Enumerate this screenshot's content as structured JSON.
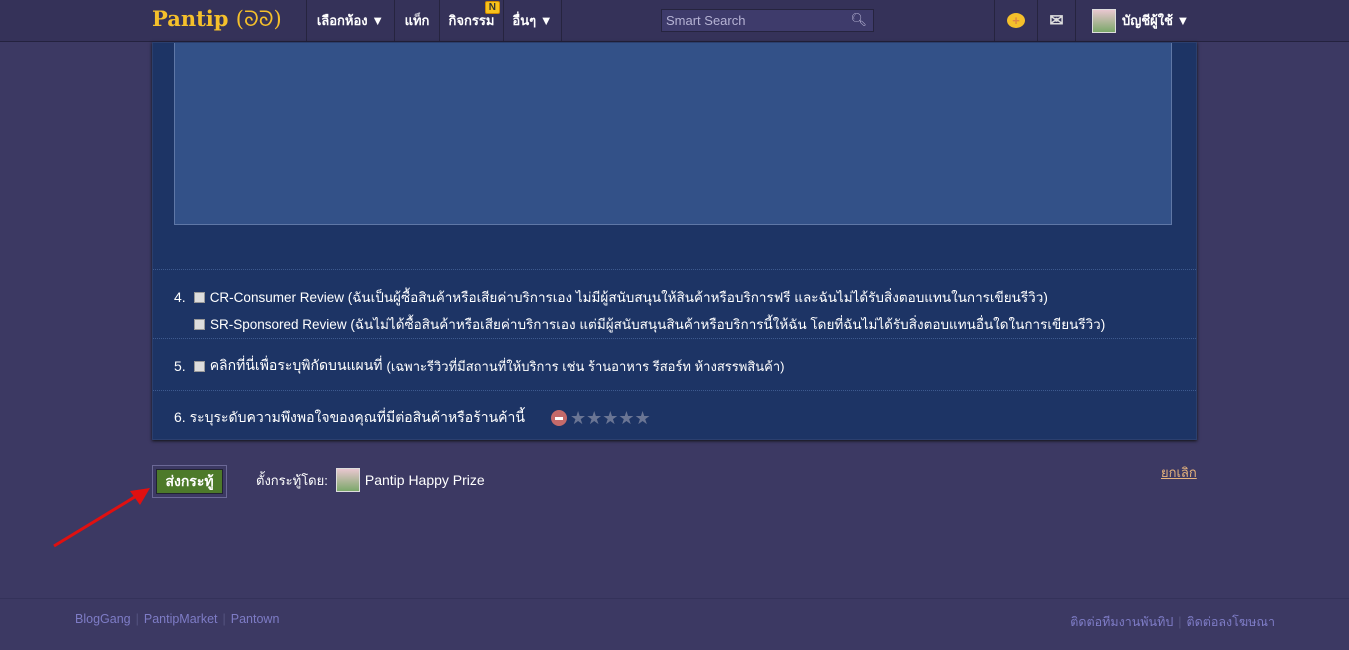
{
  "header": {
    "logo": "Pantip",
    "nav": [
      {
        "label": "เลือกห้อง ▼"
      },
      {
        "label": "แท็ก"
      },
      {
        "label": "กิจกรรม",
        "badge": "N"
      },
      {
        "label": "อื่นๆ ▼"
      }
    ],
    "search_placeholder": "Smart Search",
    "account": "บัญชีผู้ใช้ ▼"
  },
  "form": {
    "q4_num": "4.",
    "q4_opt1": "CR-Consumer Review (ฉันเป็นผู้ซื้อสินค้าหรือเสียค่าบริการเอง ไม่มีผู้สนับสนุนให้สินค้าหรือบริการฟรี และฉันไม่ได้รับสิ่งตอบแทนในการเขียนรีวิว)",
    "q4_opt2": "SR-Sponsored Review (ฉันไม่ได้ซื้อสินค้าหรือเสียค่าบริการเอง แต่มีผู้สนับสนุนสินค้าหรือบริการนี้ให้ฉัน โดยที่ฉันไม่ได้รับสิ่งตอบแทนอื่นใดในการเขียนรีวิว)",
    "q5_num": "5.",
    "q5_label": "คลิกที่นี่เพื่อระบุพิกัดบนแผนที่",
    "q5_note": "(เฉพาะรีวิวที่มีสถานที่ให้บริการ เช่น ร้านอาหาร รีสอร์ท ห้างสรรพสินค้า)",
    "q6_label": "6. ระบุระดับความพึงพอใจของคุณที่มีต่อสินค้าหรือร้านค้านี้",
    "rating": 0,
    "rating_max": 5
  },
  "actions": {
    "submit": "ส่งกระทู้",
    "posted_by_label": "ตั้งกระทู้โดย:",
    "posted_by_name": "Pantip Happy Prize",
    "cancel": "ยกเลิก"
  },
  "footer": {
    "left": [
      "BlogGang",
      "PantipMarket",
      "Pantown"
    ],
    "right": [
      "ติดต่อทีมงานพันทิป",
      "ติดต่อลงโฆษณา"
    ]
  }
}
